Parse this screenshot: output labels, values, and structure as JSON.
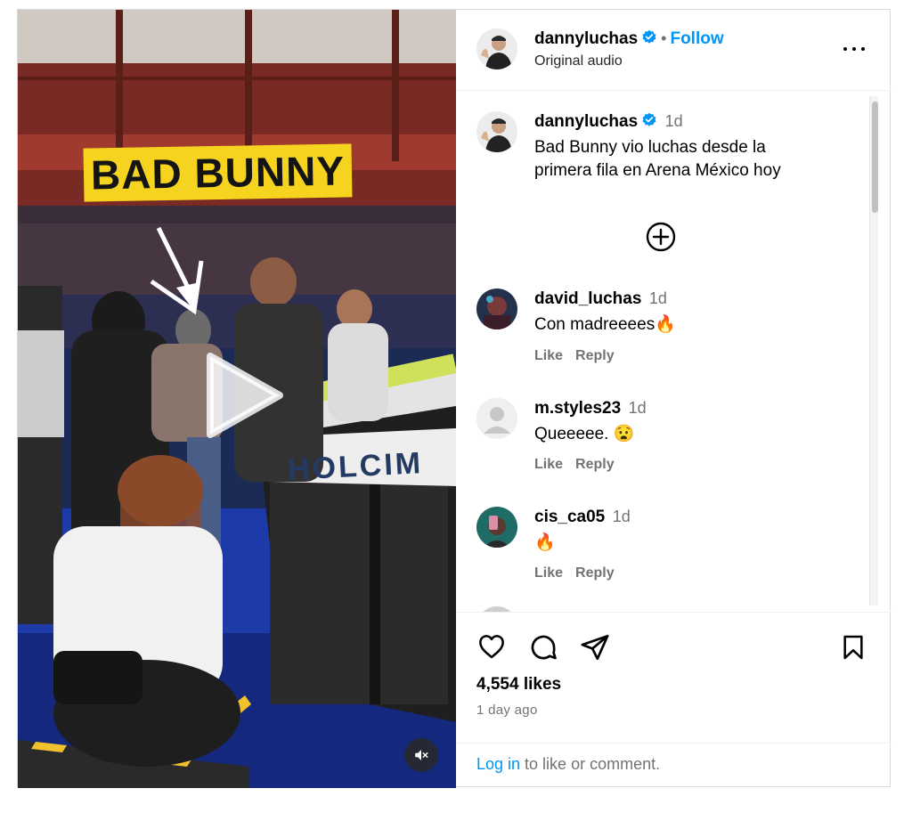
{
  "post": {
    "video": {
      "caption_overlay": "BAD BUNNY",
      "banner_text": "HOLCIM",
      "play_icon": "play-icon",
      "mute_icon": "speaker-muted-icon"
    },
    "header": {
      "username": "dannyluchas",
      "verified": true,
      "separator": "•",
      "follow_label": "Follow",
      "subtitle": "Original audio",
      "more_icon": "more-horizontal-icon"
    },
    "caption": {
      "username": "dannyluchas",
      "time": "1d",
      "text": "Bad Bunny vio luchas desde la primera fila en Arena México hoy"
    },
    "comments": [
      {
        "username": "david_luchas",
        "time": "1d",
        "text": "Con madreeees🔥",
        "like_label": "Like",
        "reply_label": "Reply"
      },
      {
        "username": "m.styles23",
        "time": "1d",
        "text": "Queeeee. 😧",
        "like_label": "Like",
        "reply_label": "Reply"
      },
      {
        "username": "cis_ca05",
        "time": "1d",
        "text": "🔥",
        "like_label": "Like",
        "reply_label": "Reply"
      }
    ],
    "footer": {
      "likes": "4,554 likes",
      "time_ago": "1 day ago",
      "login_link": "Log in",
      "login_rest": " to like or comment."
    },
    "colors": {
      "accent_blue": "#0095f6",
      "verified_blue": "#0095f6",
      "secondary_text": "#737373",
      "border": "#dbdbdb",
      "overlay_yellow": "#f5d31e"
    }
  }
}
